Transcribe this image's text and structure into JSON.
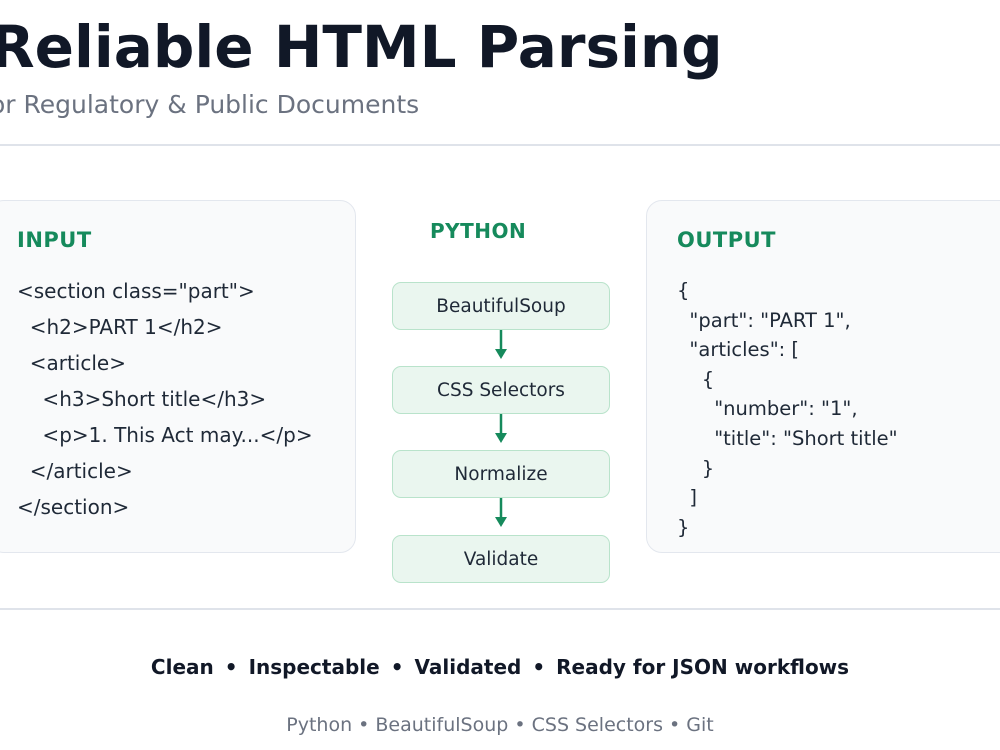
{
  "header": {
    "title": "Reliable HTML Parsing",
    "subtitle": "or Regulatory & Public Documents"
  },
  "input_panel": {
    "heading": "INPUT",
    "lines": [
      "<section class=\"part\">",
      "  <h2>PART 1</h2>",
      "  <article>",
      "    <h3>Short title</h3>",
      "    <p>1. This Act may...</p>",
      "  </article>",
      "</section>"
    ]
  },
  "pipeline": {
    "heading": "PYTHON",
    "stages": [
      "BeautifulSoup",
      "CSS Selectors",
      "Normalize",
      "Validate"
    ]
  },
  "output_panel": {
    "heading": "OUTPUT",
    "lines": [
      "{",
      "  \"part\": \"PART 1\",",
      "  \"articles\": [",
      "    {",
      "      \"number\": \"1\",",
      "      \"title\": \"Short title\"",
      "    }",
      "  ]",
      "}"
    ]
  },
  "footer": {
    "tagline_items": [
      "Clean",
      "Inspectable",
      "Validated",
      "Ready for JSON workflows"
    ],
    "tagline_separator": "•",
    "tech_stack": "Python • BeautifulSoup • CSS Selectors • Git"
  },
  "colors": {
    "accent": "#168a5c",
    "title": "#111827",
    "muted": "#6b7280",
    "stage_fill": "#eaf6ef",
    "stage_border": "#b9e3cb",
    "panel_fill": "#f9fafb",
    "panel_border": "#e3e7ee"
  }
}
